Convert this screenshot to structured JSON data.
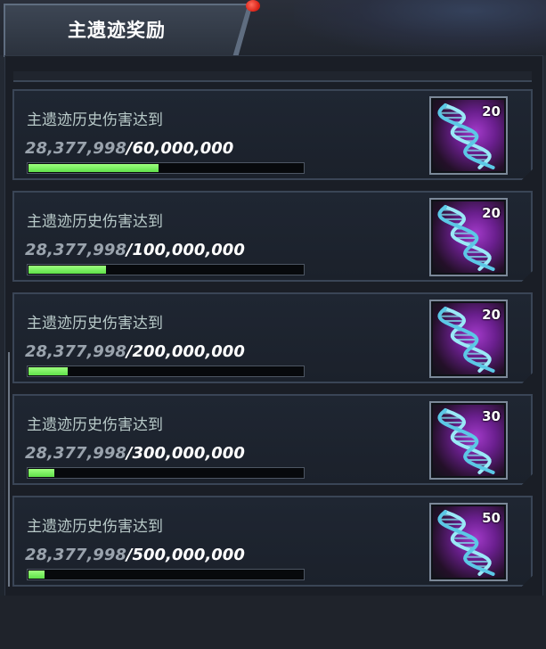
{
  "header": {
    "title": "主遗迹奖励",
    "notification_dot": true
  },
  "colors": {
    "progress_fill": "#7cf05a",
    "progress_track": "#07090c",
    "panel_bg": "#1a1e26",
    "row_border": "#3a4556",
    "reward_glow": "#a23ac9"
  },
  "rewards": [
    {
      "label": "主遗迹历史伤害达到",
      "current": "28,377,998",
      "separator": "/",
      "target": "60,000,000",
      "progress_fraction": 0.473,
      "item_icon": "dna-helix-icon",
      "item_count": "20"
    },
    {
      "label": "主遗迹历史伤害达到",
      "current": "28,377,998",
      "separator": "/",
      "target": "100,000,000",
      "progress_fraction": 0.284,
      "item_icon": "dna-helix-icon",
      "item_count": "20"
    },
    {
      "label": "主遗迹历史伤害达到",
      "current": "28,377,998",
      "separator": "/",
      "target": "200,000,000",
      "progress_fraction": 0.142,
      "item_icon": "dna-helix-icon",
      "item_count": "20"
    },
    {
      "label": "主遗迹历史伤害达到",
      "current": "28,377,998",
      "separator": "/",
      "target": "300,000,000",
      "progress_fraction": 0.095,
      "item_icon": "dna-helix-icon",
      "item_count": "30"
    },
    {
      "label": "主遗迹历史伤害达到",
      "current": "28,377,998",
      "separator": "/",
      "target": "500,000,000",
      "progress_fraction": 0.057,
      "item_icon": "dna-helix-icon",
      "item_count": "50"
    }
  ]
}
